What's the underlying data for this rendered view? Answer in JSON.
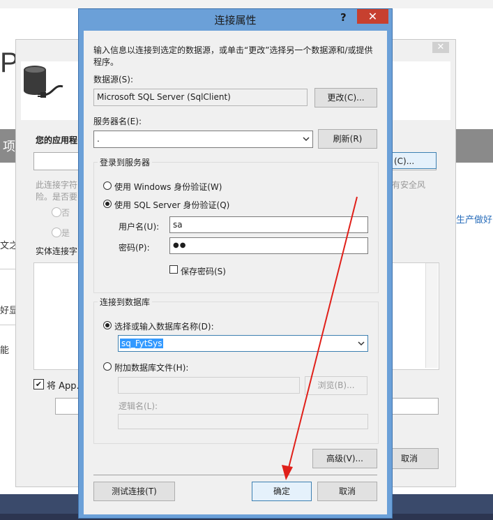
{
  "background": {
    "partial_title": "P.l",
    "band_text": "项",
    "right_link": "生产做好",
    "left_frags": [
      "文之",
      "好显",
      "能"
    ]
  },
  "middle_dialog": {
    "close_glyph": "✕",
    "app_label": "您的应用程",
    "combo_button": "(C)...",
    "desc_line1": "此连接字符",
    "desc_line2": "险。是否要",
    "desc_right": "有安全风",
    "radio_no": "否",
    "radio_yes": "是",
    "entity_label": "实体连接字",
    "save_check": "✔",
    "save_label": "将 App.C",
    "cancel_label": "取消"
  },
  "dialog": {
    "title": "连接属性",
    "help": "?",
    "close": "✕",
    "instruction_line1": "输入信息以连接到选定的数据源，或单击“更改”选择另一个数据源和/或提供",
    "instruction_line2": "程序。",
    "datasource_label": "数据源(S):",
    "datasource_value": "Microsoft SQL Server (SqlClient)",
    "change_button": "更改(C)...",
    "server_label": "服务器名(E):",
    "server_value": ".",
    "refresh_button": "刷新(R)",
    "login_group": "登录到服务器",
    "auth_windows": "使用 Windows 身份验证(W)",
    "auth_sql": "使用 SQL Server 身份验证(Q)",
    "username_label": "用户名(U):",
    "username_value": "sa",
    "password_label": "密码(P):",
    "password_value": "●●",
    "save_password": "保存密码(S)",
    "db_group": "连接到数据库",
    "select_db": "选择或输入数据库名称(D):",
    "db_value": "sq_FytSys",
    "attach_file": "附加数据库文件(H):",
    "browse_button": "浏览(B)...",
    "logical_name": "逻辑名(L):",
    "advanced_button": "高级(V)...",
    "test_button": "测试连接(T)",
    "ok_button": "确定",
    "cancel_button": "取消"
  },
  "colors": {
    "dialog_frame": "#6ba0d8",
    "close_red": "#c7402f",
    "annotation_arrow": "#e0201a",
    "selection_blue": "#3399ff"
  }
}
